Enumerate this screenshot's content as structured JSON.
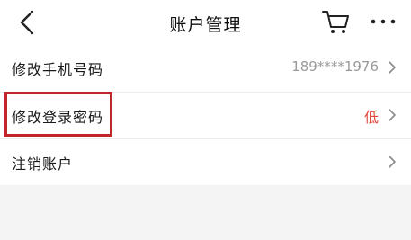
{
  "header": {
    "title": "账户管理",
    "back_icon": "back-chevron-icon",
    "cart_icon": "cart-icon",
    "more_icon": "more-dots-icon"
  },
  "settings": [
    {
      "label": "修改手机号码",
      "value": "189****1976",
      "value_color": "#9a9a9a"
    },
    {
      "label": "修改登录密码",
      "value": "低",
      "value_color": "#e14b3c"
    },
    {
      "label": "注销账户",
      "value": ""
    }
  ],
  "colors": {
    "highlight_border": "#c1262b",
    "page_background": "#f4f4f4",
    "warning_text": "#e14b3c"
  }
}
